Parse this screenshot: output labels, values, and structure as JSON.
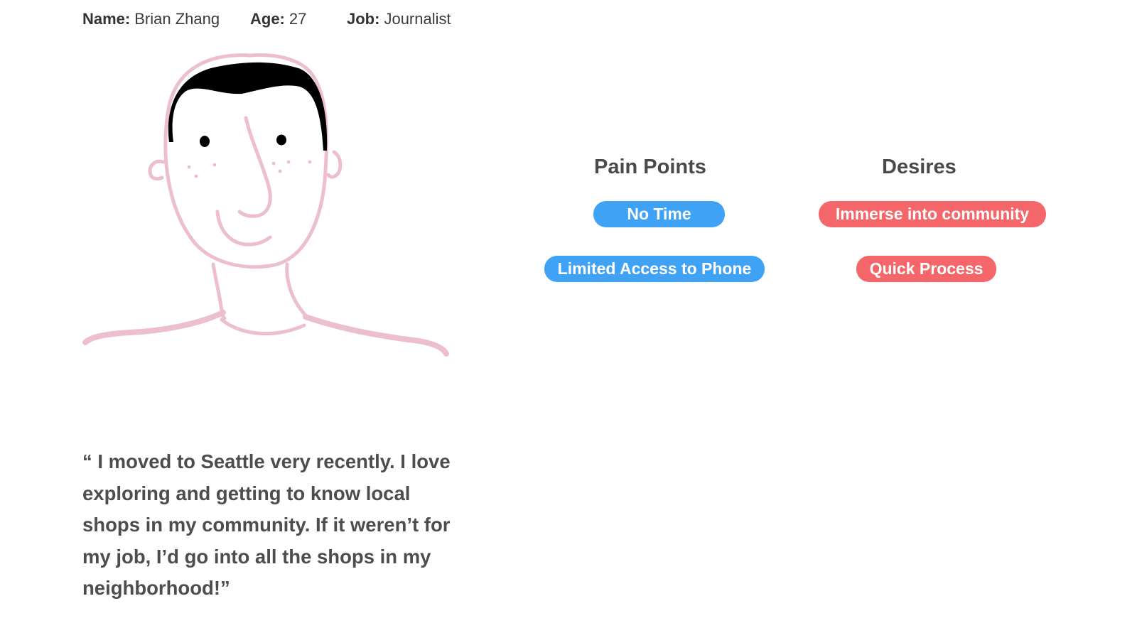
{
  "persona": {
    "name_label": "Name:",
    "name_value": "Brian Zhang",
    "age_label": "Age:",
    "age_value": "27",
    "job_label": "Job:",
    "job_value": "Journalist"
  },
  "quote": "“ I moved to Seattle very recently. I love exploring and getting to know local shops in my community. If it weren’t for my job, I’d go into all the shops in my neighborhood!”",
  "pain_points": {
    "heading": "Pain Points",
    "items": [
      "No Time",
      "Limited Access to Phone"
    ]
  },
  "desires": {
    "heading": "Desires",
    "items": [
      "Immerse into community",
      "Quick Process"
    ]
  },
  "colors": {
    "pain_pill": "#3fa2f4",
    "desire_pill": "#f4666a",
    "sketch_outline": "#ecbfd0",
    "hair": "#000000",
    "text": "#4a4a4a"
  },
  "icons": {
    "portrait": "persona-face-sketch-icon"
  }
}
